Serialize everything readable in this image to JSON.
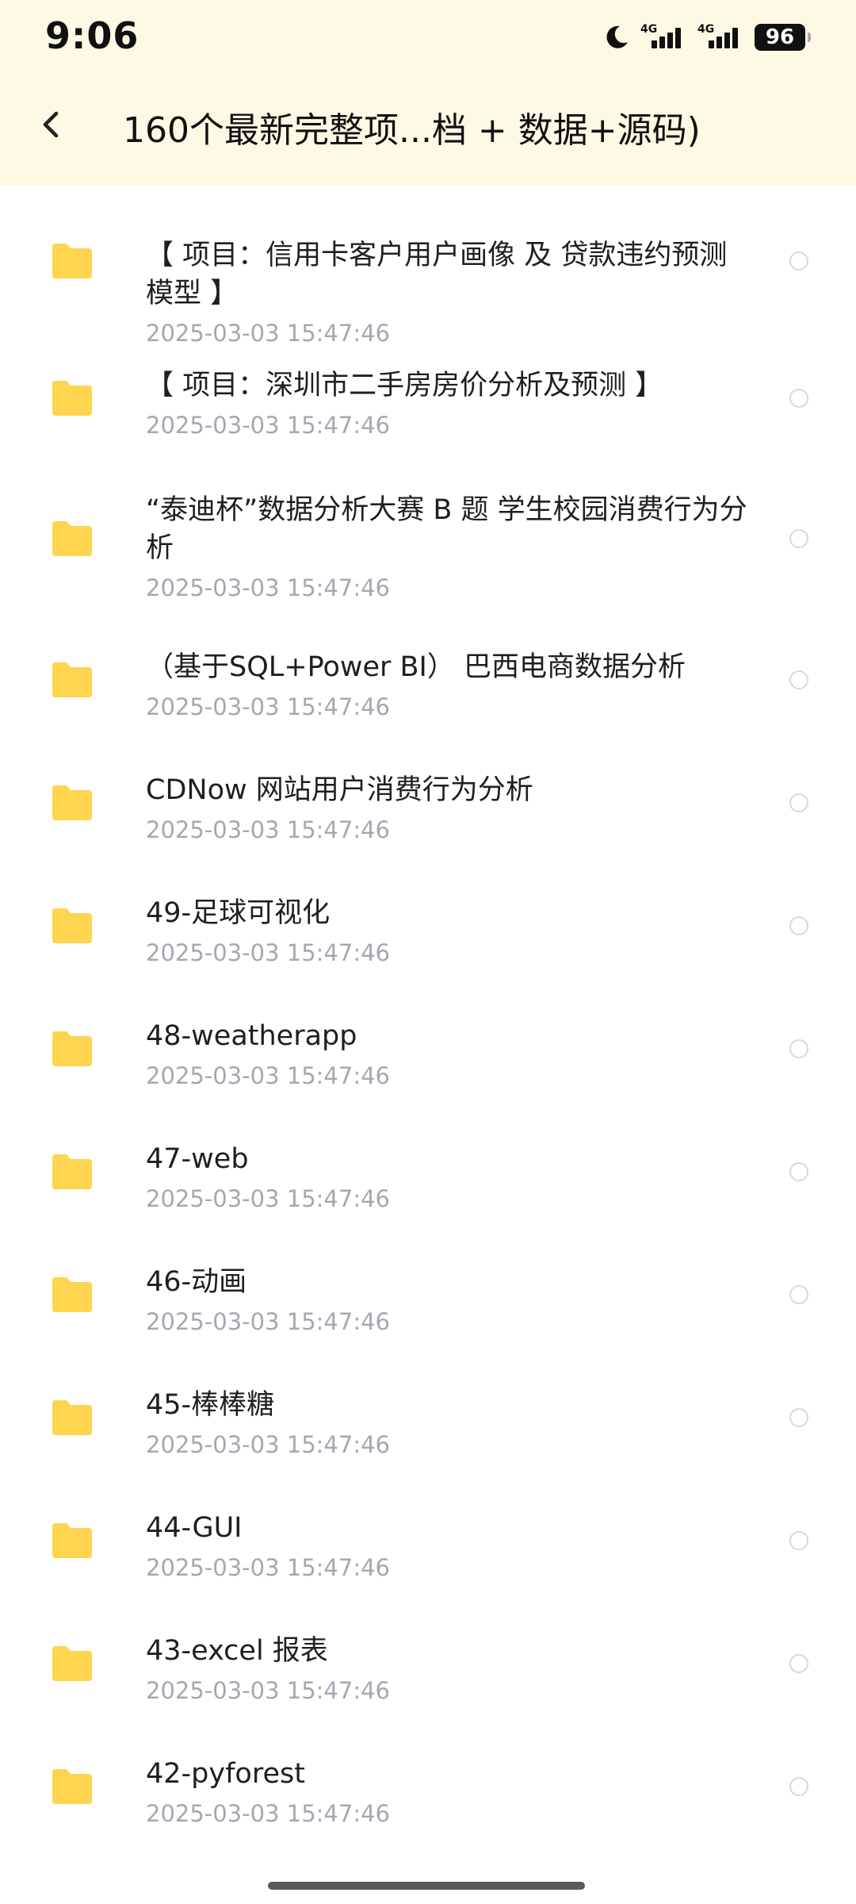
{
  "status_bar": {
    "time": "9:06",
    "network_1": "4G",
    "network_2": "4G",
    "battery": "96"
  },
  "header": {
    "title": "160个最新完整项...档 + 数据+源码)"
  },
  "items": [
    {
      "name": "【 项目：信用卡客户用户画像 及 贷款违约预测模型 】",
      "date": "2025-03-03  15:47:46"
    },
    {
      "name": "【 项目：深圳市二手房房价分析及预测 】",
      "date": "2025-03-03  15:47:46"
    },
    {
      "name": "“泰迪杯”数据分析大赛 B 题 学生校园消费行为分析",
      "date": "2025-03-03  15:47:46"
    },
    {
      "name": "（基于SQL+Power BI） 巴西电商数据分析",
      "date": "2025-03-03  15:47:46"
    },
    {
      "name": "CDNow 网站用户消费行为分析",
      "date": "2025-03-03  15:47:46"
    },
    {
      "name": "49-足球可视化",
      "date": "2025-03-03  15:47:46"
    },
    {
      "name": "48-weatherapp",
      "date": "2025-03-03  15:47:46"
    },
    {
      "name": "47-web",
      "date": "2025-03-03  15:47:46"
    },
    {
      "name": "46-动画",
      "date": "2025-03-03  15:47:46"
    },
    {
      "name": "45-棒棒糖",
      "date": "2025-03-03  15:47:46"
    },
    {
      "name": "44-GUI",
      "date": "2025-03-03  15:47:46"
    },
    {
      "name": "43-excel 报表",
      "date": "2025-03-03  15:47:46"
    },
    {
      "name": "42-pyforest",
      "date": "2025-03-03  15:47:46"
    }
  ],
  "colors": {
    "header_bg": "#fdf9e4",
    "folder": "#ffd54f",
    "date": "#a4a8b0"
  },
  "icons": {
    "back": "chevron-left-icon",
    "folder": "folder-icon",
    "moon": "moon-icon"
  }
}
